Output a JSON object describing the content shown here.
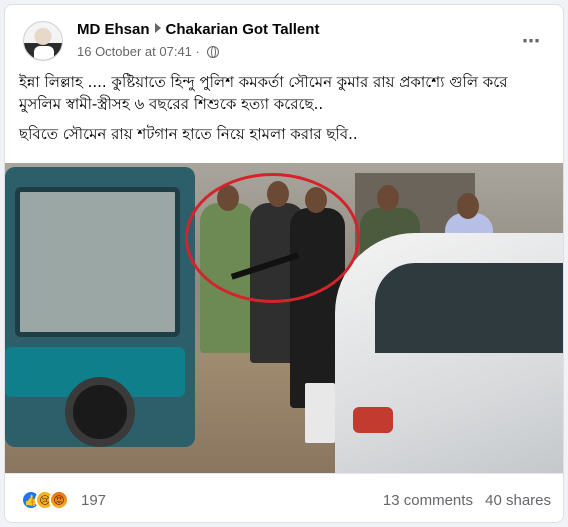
{
  "post": {
    "author": "MD Ehsan",
    "group": "Chakarian Got Tallent",
    "timestamp": "16 October at 07:41",
    "more_icon": "⋯",
    "text_lines": [
      "ইন্না লিল্লাহ .... কুষ্টিয়াতে হিন্দু পুলিশ কমকর্তা সৌমেন কুমার রায় প্রকাশ্যে গুলি করে মুসলিম স্বামী-স্ত্রীসহ ৬ বছরের শিশুকে হত্যা করেছে..",
      "ছবিতে সৌমেন রায় শটগান হাতে নিয়ে হামলা করার ছবি.."
    ]
  },
  "photo": {
    "icon": "photo-street-scene",
    "annotation_color": "#d4232b"
  },
  "footer": {
    "reaction_icons": [
      "like-icon",
      "sad-icon",
      "angry-icon"
    ],
    "reaction_glyphs": [
      "👍",
      "😢",
      "😡"
    ],
    "reaction_count": "197",
    "comments": "13 comments",
    "shares": "40 shares"
  },
  "colors": {
    "like": "#1877f2",
    "sad": "#f7b125",
    "secondary_text": "#65676b"
  }
}
